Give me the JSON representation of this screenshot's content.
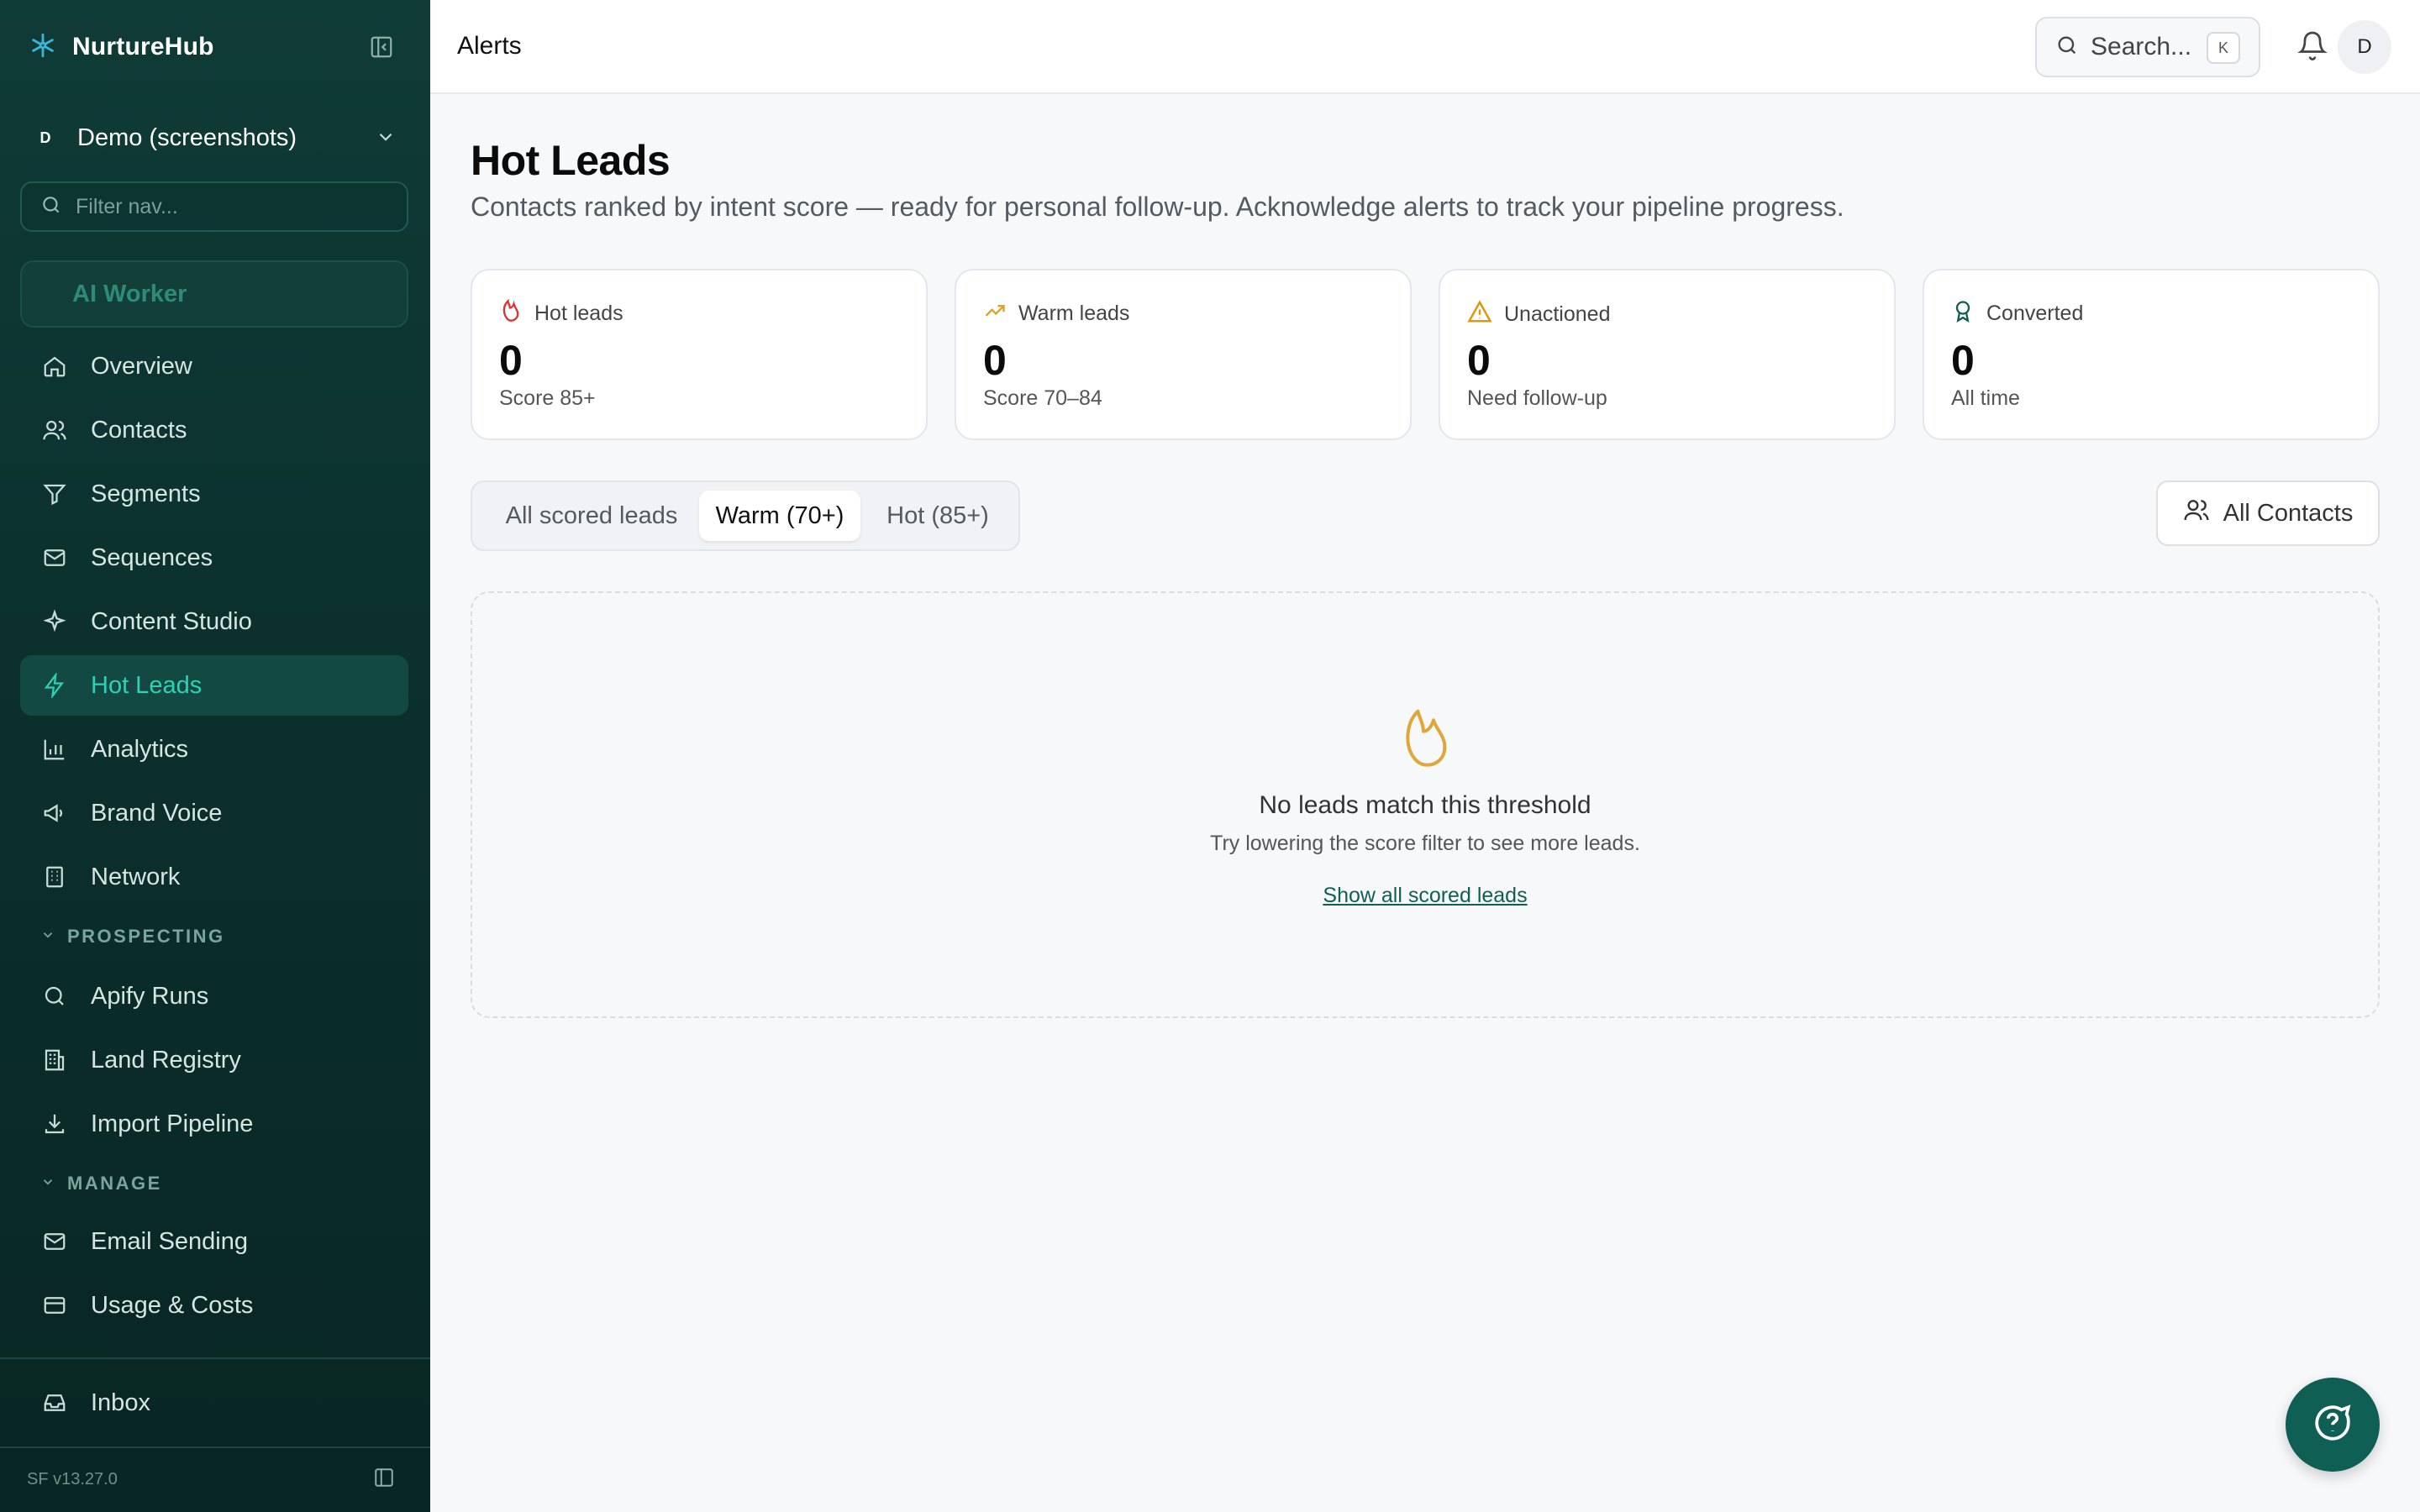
{
  "app": {
    "name": "NurtureHub",
    "accent": "#2fd1b4"
  },
  "org": {
    "badge": "D",
    "name": "Demo (screenshots)"
  },
  "nav_filter": {
    "placeholder": "Filter nav..."
  },
  "ai_worker": {
    "label": "AI Worker"
  },
  "nav": {
    "main": [
      {
        "label": "Overview",
        "icon": "home-icon"
      },
      {
        "label": "Contacts",
        "icon": "users-icon"
      },
      {
        "label": "Segments",
        "icon": "filter-icon"
      },
      {
        "label": "Sequences",
        "icon": "mail-icon"
      },
      {
        "label": "Content Studio",
        "icon": "sparkle-icon"
      },
      {
        "label": "Hot Leads",
        "icon": "zap-icon",
        "active": true
      },
      {
        "label": "Analytics",
        "icon": "bar-chart-icon"
      },
      {
        "label": "Brand Voice",
        "icon": "megaphone-icon"
      },
      {
        "label": "Network",
        "icon": "building-icon"
      }
    ],
    "prospecting_label": "PROSPECTING",
    "prospecting": [
      {
        "label": "Apify Runs",
        "icon": "search-icon"
      },
      {
        "label": "Land Registry",
        "icon": "building-columns-icon"
      },
      {
        "label": "Import Pipeline",
        "icon": "download-icon"
      }
    ],
    "manage_label": "MANAGE",
    "manage": [
      {
        "label": "Email Sending",
        "icon": "mail-icon"
      },
      {
        "label": "Usage & Costs",
        "icon": "credit-card-icon"
      }
    ],
    "inbox": {
      "label": "Inbox",
      "icon": "inbox-icon"
    }
  },
  "version": "SF v13.27.0",
  "topbar": {
    "title": "Alerts",
    "search_placeholder": "Search...",
    "search_shortcut": "K",
    "avatar": "D"
  },
  "page": {
    "title": "Hot Leads",
    "subtitle": "Contacts ranked by intent score — ready for personal follow-up. Acknowledge alerts to track your pipeline progress."
  },
  "stats": [
    {
      "label": "Hot leads",
      "value": "0",
      "sub": "Score 85+",
      "icon": "flame-icon",
      "color": "#e0312f"
    },
    {
      "label": "Warm leads",
      "value": "0",
      "sub": "Score 70–84",
      "icon": "trending-up-icon",
      "color": "#e0a11b"
    },
    {
      "label": "Unactioned",
      "value": "0",
      "sub": "Need follow-up",
      "icon": "warning-icon",
      "color": "#d99a12"
    },
    {
      "label": "Converted",
      "value": "0",
      "sub": "All time",
      "icon": "award-icon",
      "color": "#0f5f54"
    }
  ],
  "tabs": {
    "items": [
      "All scored leads",
      "Warm (70+)",
      "Hot (85+)"
    ],
    "selected": "Warm (70+)"
  },
  "all_contacts_button": "All Contacts",
  "empty_state": {
    "title": "No leads match this threshold",
    "subtitle": "Try lowering the score filter to see more leads.",
    "link": "Show all scored leads"
  }
}
